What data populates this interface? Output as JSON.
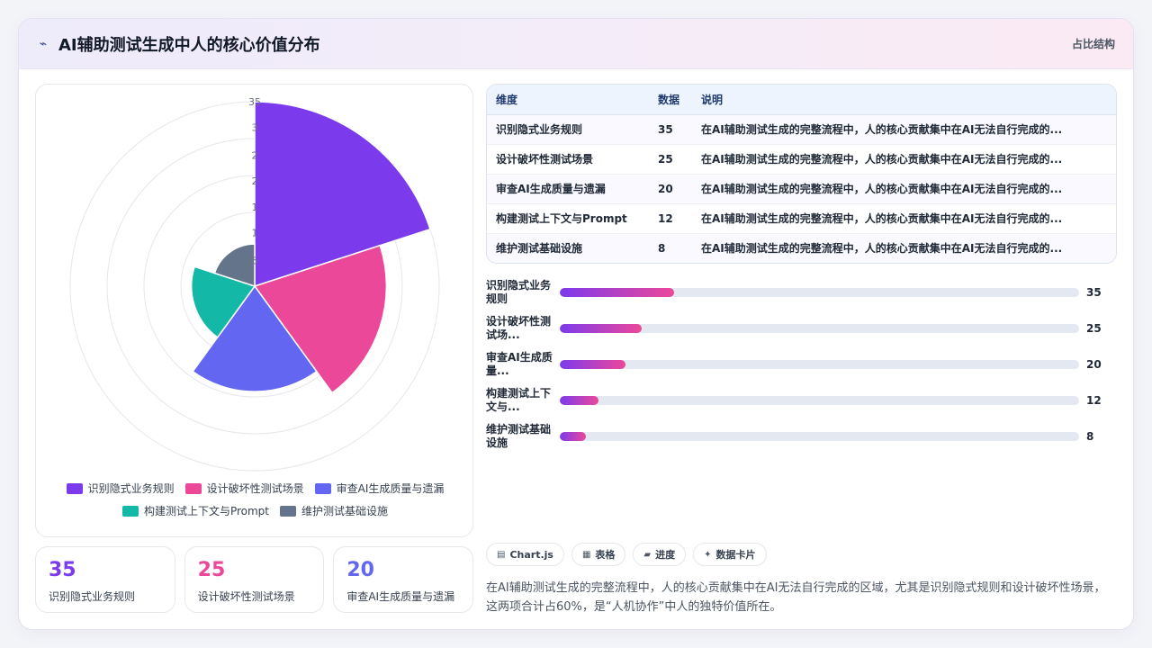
{
  "header": {
    "icon": "pulse-icon",
    "title": "AI辅助测试生成中人的核心价值分布",
    "tag": "占比结构"
  },
  "colors": {
    "purple": "#7c3aed",
    "pink": "#ec4899",
    "indigo": "#6366f1",
    "teal": "#14b8a6",
    "slate": "#64748b"
  },
  "chart_data": {
    "type": "polarArea",
    "categories": [
      "识别隐式业务规则",
      "设计破坏性测试场景",
      "审查AI生成质量与遗漏",
      "构建测试上下文与Prompt",
      "维护测试基础设施"
    ],
    "values": [
      35,
      25,
      20,
      12,
      8
    ],
    "colors": [
      "#7c3aed",
      "#ec4899",
      "#6366f1",
      "#14b8a6",
      "#64748b"
    ],
    "rmax": 35,
    "ticks": [
      "35",
      "3",
      "2",
      "2",
      "1",
      "1",
      "5"
    ],
    "grid": true,
    "legend": "bottom"
  },
  "table": {
    "headers": [
      "维度",
      "数据",
      "说明"
    ],
    "rows": [
      [
        "识别隐式业务规则",
        "35",
        "在AI辅助测试生成的完整流程中，人的核心贡献集中在AI无法自行完成的..."
      ],
      [
        "设计破坏性测试场景",
        "25",
        "在AI辅助测试生成的完整流程中，人的核心贡献集中在AI无法自行完成的..."
      ],
      [
        "审查AI生成质量与遗漏",
        "20",
        "在AI辅助测试生成的完整流程中，人的核心贡献集中在AI无法自行完成的..."
      ],
      [
        "构建测试上下文与Prompt",
        "12",
        "在AI辅助测试生成的完整流程中，人的核心贡献集中在AI无法自行完成的..."
      ],
      [
        "维护测试基础设施",
        "8",
        "在AI辅助测试生成的完整流程中，人的核心贡献集中在AI无法自行完成的..."
      ]
    ]
  },
  "bars": [
    {
      "label": "识别隐式业务规则",
      "value": 35,
      "fraction": 0.22
    },
    {
      "label": "设计破坏性测试场...",
      "value": 25,
      "fraction": 0.157
    },
    {
      "label": "审查AI生成质量...",
      "value": 20,
      "fraction": 0.126
    },
    {
      "label": "构建测试上下文与...",
      "value": 12,
      "fraction": 0.075
    },
    {
      "label": "维护测试基础设施",
      "value": 8,
      "fraction": 0.05
    }
  ],
  "stats": [
    {
      "value": "35",
      "label": "识别隐式业务规则",
      "color": "#7c3aed"
    },
    {
      "value": "25",
      "label": "设计破坏性测试场景",
      "color": "#ec4899"
    },
    {
      "value": "20",
      "label": "审查AI生成质量与遗漏",
      "color": "#6366f1"
    }
  ],
  "chips": [
    {
      "icon": "chart-icon",
      "glyph": "▤",
      "label": "Chart.js"
    },
    {
      "icon": "table-icon",
      "glyph": "▦",
      "label": "表格"
    },
    {
      "icon": "progress-icon",
      "glyph": "▰",
      "label": "进度"
    },
    {
      "icon": "sparkle-icon",
      "glyph": "✦",
      "label": "数据卡片"
    }
  ],
  "summary": "在AI辅助测试生成的完整流程中，人的核心贡献集中在AI无法自行完成的区域，尤其是识别隐式规则和设计破坏性场景，这两项合计占60%，是“人机协作”中人的独特价值所在。"
}
